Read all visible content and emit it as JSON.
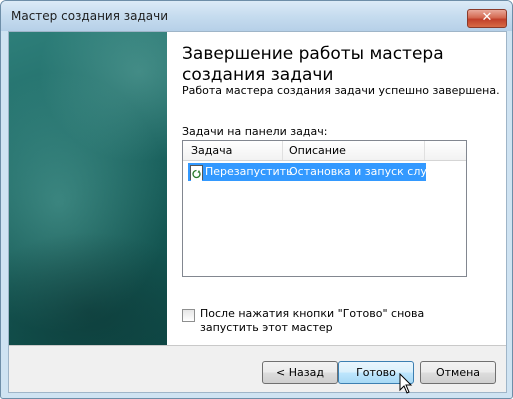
{
  "window": {
    "title": "Мастер создания задачи",
    "close_symbol": "✕"
  },
  "main": {
    "heading": "Завершение работы мастера создания задачи",
    "subtitle": "Работа мастера создания задачи успешно завершена.",
    "list_label": "Задачи на панели задач:",
    "columns": [
      "Задача",
      "Описание"
    ],
    "rows": [
      {
        "task": "Перезапустить",
        "description": "Остановка и запуск служ..."
      }
    ],
    "checkbox": {
      "label": "После нажатия кнопки \"Готово\" снова запустить этот мастер",
      "checked": false
    }
  },
  "buttons": {
    "back": "< Назад",
    "finish": "Готово",
    "cancel": "Отмена"
  },
  "colors": {
    "sidebar": "#1f6a66",
    "selection": "#3399ff"
  }
}
